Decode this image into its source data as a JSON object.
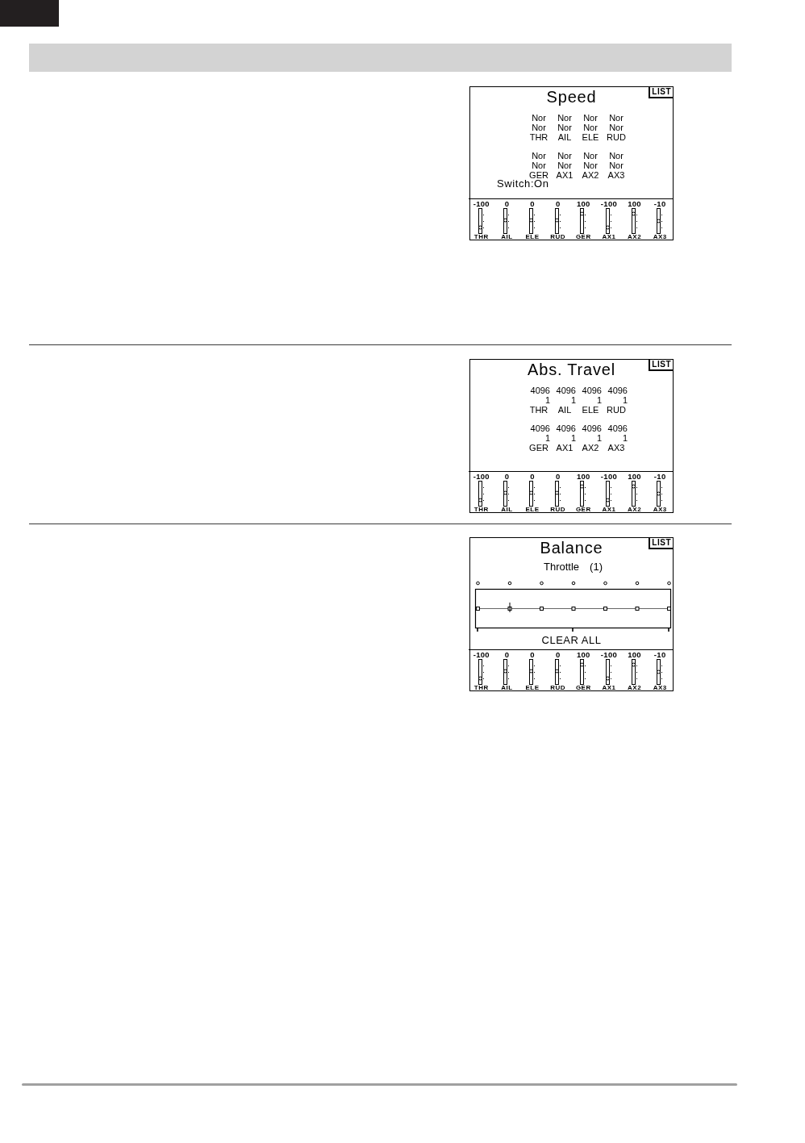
{
  "screens": [
    {
      "kind": "speed",
      "title": "Speed",
      "badge": "LIST",
      "groups": [
        {
          "rows": [
            [
              "Nor",
              "Nor",
              "Nor",
              "Nor"
            ],
            [
              "Nor",
              "Nor",
              "Nor",
              "Nor"
            ]
          ],
          "channels": [
            "THR",
            "AIL",
            "ELE",
            "RUD"
          ]
        },
        {
          "rows": [
            [
              "Nor",
              "Nor",
              "Nor",
              "Nor"
            ],
            [
              "Nor",
              "Nor",
              "Nor",
              "Nor"
            ]
          ],
          "channels": [
            "GER",
            "AX1",
            "AX2",
            "AX3"
          ]
        }
      ],
      "switch": "Switch:On",
      "monitor": [
        {
          "value": "-100",
          "level": 0.25,
          "channel": "THR"
        },
        {
          "value": "0",
          "level": 0.56,
          "channel": "AIL"
        },
        {
          "value": "0",
          "level": 0.56,
          "channel": "ELE"
        },
        {
          "value": "0",
          "level": 0.56,
          "channel": "RUD"
        },
        {
          "value": "100",
          "level": 0.88,
          "channel": "GER"
        },
        {
          "value": "-100",
          "level": 0.25,
          "channel": "AX1"
        },
        {
          "value": "100",
          "level": 0.88,
          "channel": "AX2"
        },
        {
          "value": "-10",
          "level": 0.53,
          "channel": "AX3"
        }
      ]
    },
    {
      "kind": "travel",
      "title": "Abs. Travel",
      "badge": "LIST",
      "groups": [
        {
          "rows": [
            [
              "4096",
              "4096",
              "4096",
              "4096"
            ],
            [
              "1",
              "1",
              "1",
              "1"
            ]
          ],
          "channels": [
            "THR",
            "AIL",
            "ELE",
            "RUD"
          ]
        },
        {
          "rows": [
            [
              "4096",
              "4096",
              "4096",
              "4096"
            ],
            [
              "1",
              "1",
              "1",
              "1"
            ]
          ],
          "channels": [
            "GER",
            "AX1",
            "AX2",
            "AX3"
          ]
        }
      ],
      "monitor": [
        {
          "value": "-100",
          "level": 0.25,
          "channel": "THR"
        },
        {
          "value": "0",
          "level": 0.56,
          "channel": "AIL"
        },
        {
          "value": "0",
          "level": 0.56,
          "channel": "ELE"
        },
        {
          "value": "0",
          "level": 0.56,
          "channel": "RUD"
        },
        {
          "value": "100",
          "level": 0.88,
          "channel": "GER"
        },
        {
          "value": "-100",
          "level": 0.25,
          "channel": "AX1"
        },
        {
          "value": "100",
          "level": 0.88,
          "channel": "AX2"
        },
        {
          "value": "-10",
          "level": 0.53,
          "channel": "AX3"
        }
      ]
    },
    {
      "kind": "balance",
      "title": "Balance",
      "badge": "LIST",
      "subtitle": "Throttle",
      "index": "(1)",
      "points": [
        {
          "selected": false
        },
        {
          "selected": true
        },
        {
          "selected": false
        },
        {
          "selected": false
        },
        {
          "selected": false
        },
        {
          "selected": false
        },
        {
          "selected": false
        }
      ],
      "action": "CLEAR ALL",
      "monitor": [
        {
          "value": "-100",
          "level": 0.25,
          "channel": "THR"
        },
        {
          "value": "0",
          "level": 0.56,
          "channel": "AIL"
        },
        {
          "value": "0",
          "level": 0.56,
          "channel": "ELE"
        },
        {
          "value": "0",
          "level": 0.56,
          "channel": "RUD"
        },
        {
          "value": "100",
          "level": 0.88,
          "channel": "GER"
        },
        {
          "value": "-100",
          "level": 0.25,
          "channel": "AX1"
        },
        {
          "value": "100",
          "level": 0.88,
          "channel": "AX2"
        },
        {
          "value": "-10",
          "level": 0.53,
          "channel": "AX3"
        }
      ]
    }
  ]
}
